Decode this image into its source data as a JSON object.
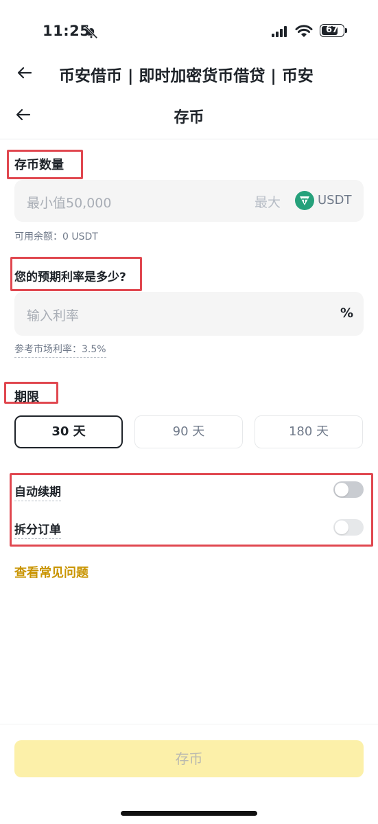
{
  "status_bar": {
    "time": "11:25",
    "battery": "67"
  },
  "header": {
    "title": "币安借币 | 即时加密货币借贷 | 币安"
  },
  "nav": {
    "title": "存币"
  },
  "amount": {
    "label": "存币数量",
    "placeholder": "最小值50,000",
    "max_label": "最大",
    "currency": "USDT",
    "available": "可用余额：0 USDT"
  },
  "rate": {
    "label": "您的预期利率是多少?",
    "placeholder": "输入利率",
    "unit": "%",
    "reference": "参考市场利率：3.5%"
  },
  "term": {
    "label": "期限",
    "options": [
      "30 天",
      "90 天",
      "180 天"
    ],
    "selected": "30 天"
  },
  "toggles": {
    "auto_renew": {
      "label": "自动续期",
      "on": false
    },
    "split_order": {
      "label": "拆分订单",
      "on": false
    }
  },
  "faq_link": "查看常见问题",
  "submit_label": "存币",
  "colors": {
    "accent": "#c99400",
    "highlight": "#e0474f",
    "submit_bg": "#fcf0a9",
    "tether": "#26a17b"
  }
}
